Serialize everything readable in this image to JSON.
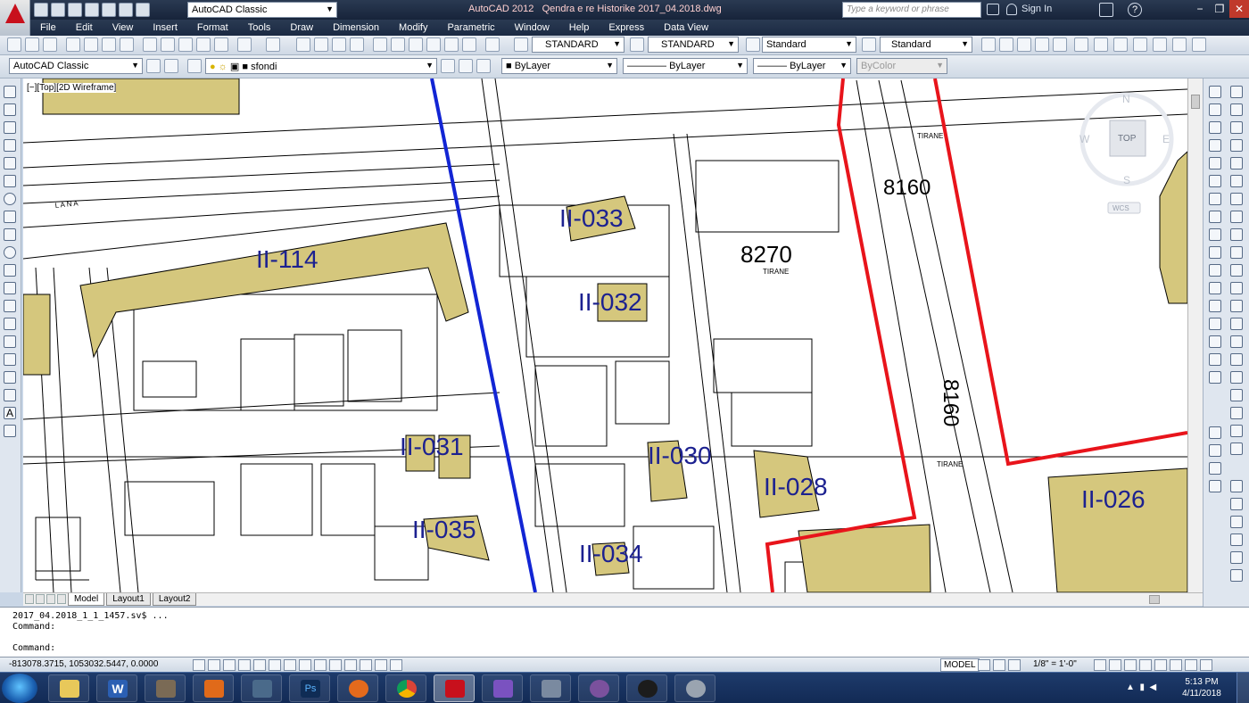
{
  "window": {
    "app_name": "AutoCAD 2012",
    "file_name": "Qendra e re Historike 2017_04.2018.dwg",
    "workspace": "AutoCAD Classic",
    "search_placeholder": "Type a keyword or phrase",
    "signin_label": "Sign In"
  },
  "menu": [
    "File",
    "Edit",
    "View",
    "Insert",
    "Format",
    "Tools",
    "Draw",
    "Dimension",
    "Modify",
    "Parametric",
    "Window",
    "Help",
    "Express",
    "Data View"
  ],
  "styles_toolbar": {
    "text_style": "STANDARD",
    "dim_style": "STANDARD",
    "table_style": "Standard",
    "mleader_style": "Standard"
  },
  "layers_toolbar": {
    "workspace": "AutoCAD Classic",
    "current_layer": "sfondi",
    "color": "ByLayer",
    "linetype": "ByLayer",
    "lineweight": "ByLayer",
    "plotstyle": "ByColor"
  },
  "viewport": {
    "label": "[−][Top][2D Wireframe]",
    "viewcube_top": "TOP",
    "compass": {
      "n": "N",
      "s": "S",
      "e": "E",
      "w": "W"
    },
    "ucs": "WCS"
  },
  "drawing": {
    "parcels": [
      "II-033",
      "II-114",
      "II-032",
      "II-031",
      "II-030",
      "II-028",
      "II-035",
      "II-034",
      "II-026"
    ],
    "zones": [
      "8160",
      "8270",
      "8160"
    ],
    "city_labels": [
      "TIRANE",
      "TIRANE",
      "TIRANE"
    ],
    "street_label": "L A N A",
    "accent_red": "#e8141b",
    "accent_blue": "#1225d4",
    "building_fill": "#d5c77d"
  },
  "layout_tabs": [
    "Model",
    "Layout1",
    "Layout2"
  ],
  "command_line": {
    "history_1": "2017_04.2018_1_1_1457.sv$ ...",
    "history_2": "Command:",
    "prompt": "Command:"
  },
  "status_bar": {
    "coords": "-813078.3715, 1053032.5447, 0.0000",
    "space": "MODEL",
    "scale": "1/8\" = 1'-0\""
  },
  "taskbar": {
    "time": "5:13 PM",
    "date": "4/11/2018"
  }
}
